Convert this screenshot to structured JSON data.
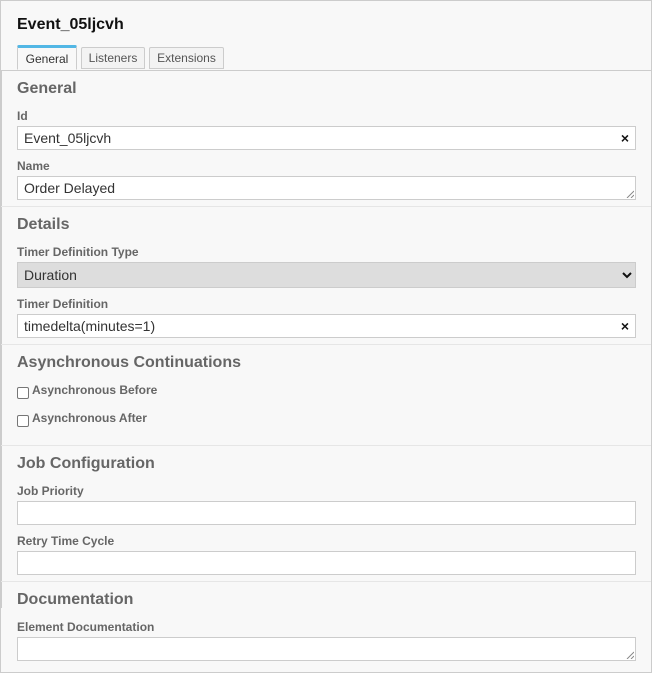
{
  "header": {
    "title": "Event_05ljcvh",
    "tabs": [
      {
        "label": "General",
        "active": true
      },
      {
        "label": "Listeners",
        "active": false
      },
      {
        "label": "Extensions",
        "active": false
      }
    ]
  },
  "groups": {
    "general": {
      "title": "General",
      "id_label": "Id",
      "id_value": "Event_05ljcvh",
      "name_label": "Name",
      "name_value": "Order Delayed"
    },
    "details": {
      "title": "Details",
      "timer_type_label": "Timer Definition Type",
      "timer_type_value": "Duration",
      "timer_def_label": "Timer Definition",
      "timer_def_value": "timedelta(minutes=1)"
    },
    "async": {
      "title": "Asynchronous Continuations",
      "before_label": "Asynchronous Before",
      "before_checked": false,
      "after_label": "Asynchronous After",
      "after_checked": false
    },
    "job": {
      "title": "Job Configuration",
      "priority_label": "Job Priority",
      "priority_value": "",
      "retry_label": "Retry Time Cycle",
      "retry_value": ""
    },
    "documentation": {
      "title": "Documentation",
      "element_doc_label": "Element Documentation",
      "element_doc_value": ""
    }
  },
  "icons": {
    "clear": "×",
    "dropdown": "chevron-down-icon"
  },
  "colors": {
    "tab_active_accent": "#52b7e5",
    "panel_bg": "#f8f8f8",
    "select_bg": "#dddddd"
  }
}
